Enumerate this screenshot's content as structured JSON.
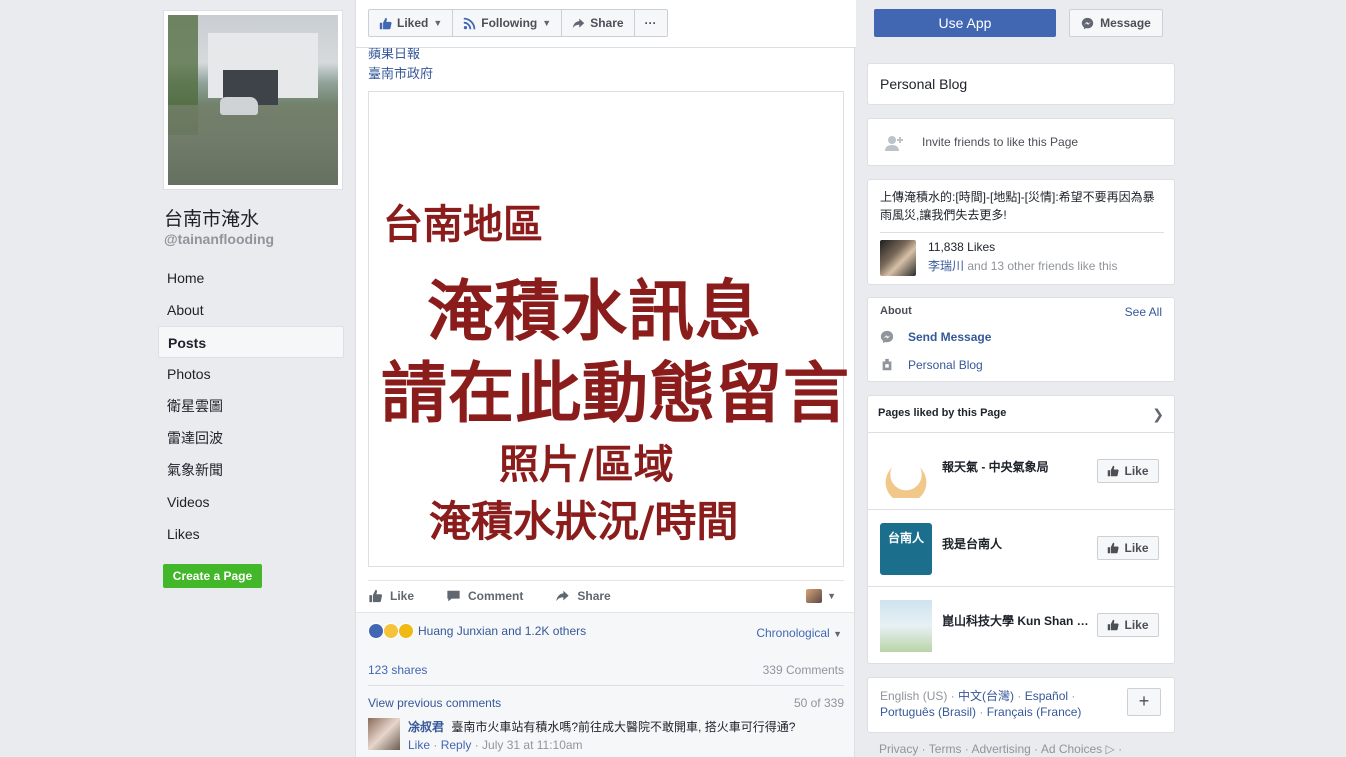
{
  "left": {
    "page_name": "台南市淹水",
    "page_handle": "@tainanflooding",
    "nav": [
      {
        "label": "Home"
      },
      {
        "label": "About"
      },
      {
        "label": "Posts",
        "active": true
      },
      {
        "label": "Photos"
      },
      {
        "label": "衛星雲圖"
      },
      {
        "label": "雷達回波"
      },
      {
        "label": "氣象新聞"
      },
      {
        "label": "Videos"
      },
      {
        "label": "Likes"
      }
    ],
    "create_page": "Create a Page"
  },
  "topbar": {
    "liked": "Liked",
    "following": "Following",
    "share": "Share",
    "more": "···"
  },
  "post": {
    "source_line_1": "蘋果日報",
    "source_line_2": "臺南市政府",
    "image_lines": [
      "台南地區",
      "淹積水訊息",
      "請在此動態留言",
      "照片/區域",
      "淹積水狀況/時間"
    ],
    "actions": {
      "like": "Like",
      "comment": "Comment",
      "share": "Share"
    },
    "reactions_text": "Huang Junxian and 1.2K others",
    "sort": "Chronological",
    "shares": "123 shares",
    "comments_count": "339 Comments",
    "view_previous": "View previous comments",
    "pagination": "50 of 339",
    "comment": {
      "author": "凃叔君",
      "text": "臺南市火車站有積水嗎?前往成大醫院不敢開車, 搭火車可行得通?",
      "like": "Like",
      "reply": "Reply",
      "time": "July 31 at 11:10am"
    }
  },
  "right": {
    "use_app": "Use App",
    "message": "Message",
    "category": "Personal Blog",
    "invite": "Invite friends to like this Page",
    "description": "上傳淹積水的:[時間]-[地點]-[災情]:希望不要再因為暴雨風災,讓我們失去更多!",
    "likes_count": "11,838 Likes",
    "likes_friend": "李瑞川",
    "likes_friends_rest": " and 13 other friends like this",
    "about_title": "About",
    "see_all": "See All",
    "send_message": "Send Message",
    "about_blog": "Personal Blog",
    "pages_liked_title": "Pages liked by this Page",
    "liked_pages": [
      {
        "name": "報天氣 - 中央氣象局",
        "button": "Like"
      },
      {
        "name": "我是台南人",
        "button": "Like",
        "thumb_text": "台南人"
      },
      {
        "name": "崑山科技大學 Kun Shan University",
        "button": "Like"
      }
    ],
    "languages": {
      "lang_current": "English (US)",
      "lang_1": "中文(台灣)",
      "lang_2": "Español",
      "lang_3": "Português (Brasil)",
      "lang_4": "Français (France)",
      "sep": " · "
    },
    "plus": "+",
    "footer": "Privacy · Terms · Advertising · Ad Choices ▷ ·"
  },
  "colors": {
    "fb_blue": "#4267b2",
    "link": "#365899",
    "create_green": "#42b72a",
    "poster_red": "#8b1c1c"
  }
}
